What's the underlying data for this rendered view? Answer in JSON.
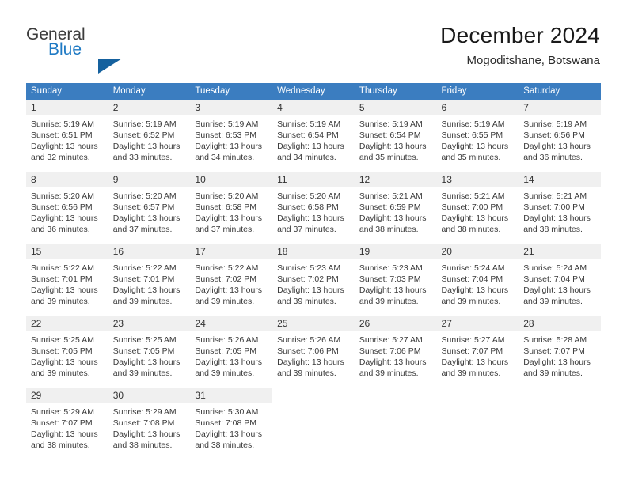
{
  "brand": {
    "name_part1": "General",
    "name_part2": "Blue",
    "accent_color": "#15619e"
  },
  "header": {
    "title": "December 2024",
    "subtitle": "Mogoditshane, Botswana"
  },
  "colors": {
    "header_row_bg": "#3b7dc0",
    "row_separator": "#2a6bb0",
    "daynum_bg": "#f0f0f0",
    "brand_blue": "#1f7ac4"
  },
  "weekday_headers": [
    "Sunday",
    "Monday",
    "Tuesday",
    "Wednesday",
    "Thursday",
    "Friday",
    "Saturday"
  ],
  "weeks": [
    [
      {
        "day": "1",
        "sunrise": "Sunrise: 5:19 AM",
        "sunset": "Sunset: 6:51 PM",
        "daylight1": "Daylight: 13 hours",
        "daylight2": "and 32 minutes."
      },
      {
        "day": "2",
        "sunrise": "Sunrise: 5:19 AM",
        "sunset": "Sunset: 6:52 PM",
        "daylight1": "Daylight: 13 hours",
        "daylight2": "and 33 minutes."
      },
      {
        "day": "3",
        "sunrise": "Sunrise: 5:19 AM",
        "sunset": "Sunset: 6:53 PM",
        "daylight1": "Daylight: 13 hours",
        "daylight2": "and 34 minutes."
      },
      {
        "day": "4",
        "sunrise": "Sunrise: 5:19 AM",
        "sunset": "Sunset: 6:54 PM",
        "daylight1": "Daylight: 13 hours",
        "daylight2": "and 34 minutes."
      },
      {
        "day": "5",
        "sunrise": "Sunrise: 5:19 AM",
        "sunset": "Sunset: 6:54 PM",
        "daylight1": "Daylight: 13 hours",
        "daylight2": "and 35 minutes."
      },
      {
        "day": "6",
        "sunrise": "Sunrise: 5:19 AM",
        "sunset": "Sunset: 6:55 PM",
        "daylight1": "Daylight: 13 hours",
        "daylight2": "and 35 minutes."
      },
      {
        "day": "7",
        "sunrise": "Sunrise: 5:19 AM",
        "sunset": "Sunset: 6:56 PM",
        "daylight1": "Daylight: 13 hours",
        "daylight2": "and 36 minutes."
      }
    ],
    [
      {
        "day": "8",
        "sunrise": "Sunrise: 5:20 AM",
        "sunset": "Sunset: 6:56 PM",
        "daylight1": "Daylight: 13 hours",
        "daylight2": "and 36 minutes."
      },
      {
        "day": "9",
        "sunrise": "Sunrise: 5:20 AM",
        "sunset": "Sunset: 6:57 PM",
        "daylight1": "Daylight: 13 hours",
        "daylight2": "and 37 minutes."
      },
      {
        "day": "10",
        "sunrise": "Sunrise: 5:20 AM",
        "sunset": "Sunset: 6:58 PM",
        "daylight1": "Daylight: 13 hours",
        "daylight2": "and 37 minutes."
      },
      {
        "day": "11",
        "sunrise": "Sunrise: 5:20 AM",
        "sunset": "Sunset: 6:58 PM",
        "daylight1": "Daylight: 13 hours",
        "daylight2": "and 37 minutes."
      },
      {
        "day": "12",
        "sunrise": "Sunrise: 5:21 AM",
        "sunset": "Sunset: 6:59 PM",
        "daylight1": "Daylight: 13 hours",
        "daylight2": "and 38 minutes."
      },
      {
        "day": "13",
        "sunrise": "Sunrise: 5:21 AM",
        "sunset": "Sunset: 7:00 PM",
        "daylight1": "Daylight: 13 hours",
        "daylight2": "and 38 minutes."
      },
      {
        "day": "14",
        "sunrise": "Sunrise: 5:21 AM",
        "sunset": "Sunset: 7:00 PM",
        "daylight1": "Daylight: 13 hours",
        "daylight2": "and 38 minutes."
      }
    ],
    [
      {
        "day": "15",
        "sunrise": "Sunrise: 5:22 AM",
        "sunset": "Sunset: 7:01 PM",
        "daylight1": "Daylight: 13 hours",
        "daylight2": "and 39 minutes."
      },
      {
        "day": "16",
        "sunrise": "Sunrise: 5:22 AM",
        "sunset": "Sunset: 7:01 PM",
        "daylight1": "Daylight: 13 hours",
        "daylight2": "and 39 minutes."
      },
      {
        "day": "17",
        "sunrise": "Sunrise: 5:22 AM",
        "sunset": "Sunset: 7:02 PM",
        "daylight1": "Daylight: 13 hours",
        "daylight2": "and 39 minutes."
      },
      {
        "day": "18",
        "sunrise": "Sunrise: 5:23 AM",
        "sunset": "Sunset: 7:02 PM",
        "daylight1": "Daylight: 13 hours",
        "daylight2": "and 39 minutes."
      },
      {
        "day": "19",
        "sunrise": "Sunrise: 5:23 AM",
        "sunset": "Sunset: 7:03 PM",
        "daylight1": "Daylight: 13 hours",
        "daylight2": "and 39 minutes."
      },
      {
        "day": "20",
        "sunrise": "Sunrise: 5:24 AM",
        "sunset": "Sunset: 7:04 PM",
        "daylight1": "Daylight: 13 hours",
        "daylight2": "and 39 minutes."
      },
      {
        "day": "21",
        "sunrise": "Sunrise: 5:24 AM",
        "sunset": "Sunset: 7:04 PM",
        "daylight1": "Daylight: 13 hours",
        "daylight2": "and 39 minutes."
      }
    ],
    [
      {
        "day": "22",
        "sunrise": "Sunrise: 5:25 AM",
        "sunset": "Sunset: 7:05 PM",
        "daylight1": "Daylight: 13 hours",
        "daylight2": "and 39 minutes."
      },
      {
        "day": "23",
        "sunrise": "Sunrise: 5:25 AM",
        "sunset": "Sunset: 7:05 PM",
        "daylight1": "Daylight: 13 hours",
        "daylight2": "and 39 minutes."
      },
      {
        "day": "24",
        "sunrise": "Sunrise: 5:26 AM",
        "sunset": "Sunset: 7:05 PM",
        "daylight1": "Daylight: 13 hours",
        "daylight2": "and 39 minutes."
      },
      {
        "day": "25",
        "sunrise": "Sunrise: 5:26 AM",
        "sunset": "Sunset: 7:06 PM",
        "daylight1": "Daylight: 13 hours",
        "daylight2": "and 39 minutes."
      },
      {
        "day": "26",
        "sunrise": "Sunrise: 5:27 AM",
        "sunset": "Sunset: 7:06 PM",
        "daylight1": "Daylight: 13 hours",
        "daylight2": "and 39 minutes."
      },
      {
        "day": "27",
        "sunrise": "Sunrise: 5:27 AM",
        "sunset": "Sunset: 7:07 PM",
        "daylight1": "Daylight: 13 hours",
        "daylight2": "and 39 minutes."
      },
      {
        "day": "28",
        "sunrise": "Sunrise: 5:28 AM",
        "sunset": "Sunset: 7:07 PM",
        "daylight1": "Daylight: 13 hours",
        "daylight2": "and 39 minutes."
      }
    ],
    [
      {
        "day": "29",
        "sunrise": "Sunrise: 5:29 AM",
        "sunset": "Sunset: 7:07 PM",
        "daylight1": "Daylight: 13 hours",
        "daylight2": "and 38 minutes."
      },
      {
        "day": "30",
        "sunrise": "Sunrise: 5:29 AM",
        "sunset": "Sunset: 7:08 PM",
        "daylight1": "Daylight: 13 hours",
        "daylight2": "and 38 minutes."
      },
      {
        "day": "31",
        "sunrise": "Sunrise: 5:30 AM",
        "sunset": "Sunset: 7:08 PM",
        "daylight1": "Daylight: 13 hours",
        "daylight2": "and 38 minutes."
      },
      {
        "day": "",
        "sunrise": "",
        "sunset": "",
        "daylight1": "",
        "daylight2": ""
      },
      {
        "day": "",
        "sunrise": "",
        "sunset": "",
        "daylight1": "",
        "daylight2": ""
      },
      {
        "day": "",
        "sunrise": "",
        "sunset": "",
        "daylight1": "",
        "daylight2": ""
      },
      {
        "day": "",
        "sunrise": "",
        "sunset": "",
        "daylight1": "",
        "daylight2": ""
      }
    ]
  ]
}
